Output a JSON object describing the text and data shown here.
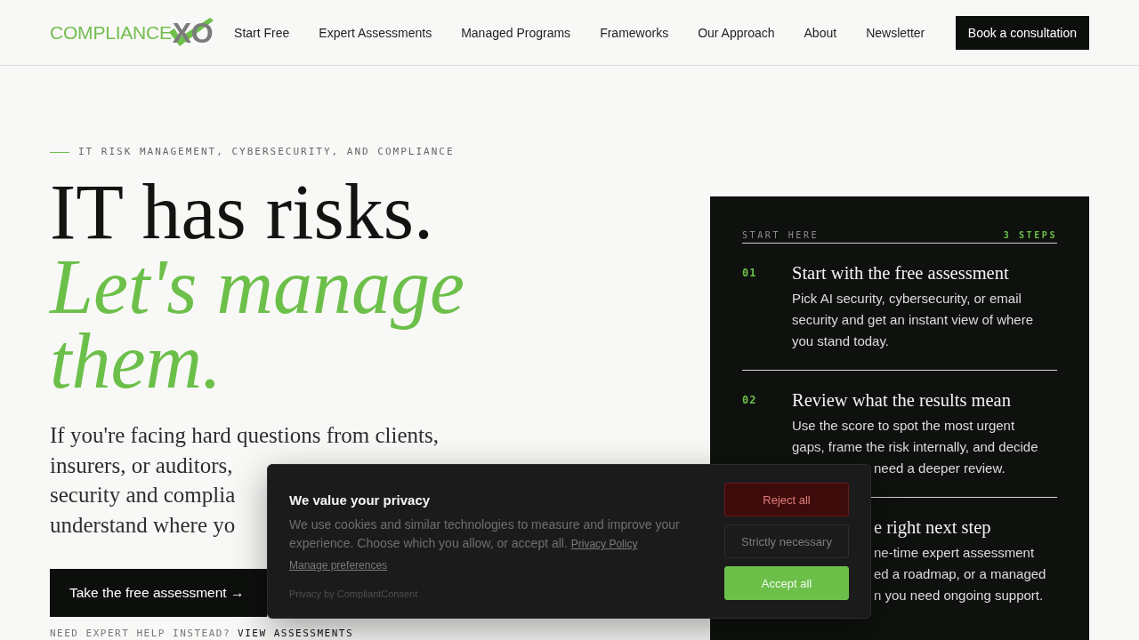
{
  "header": {
    "logo": {
      "wordmark": "COMPLIANCE",
      "letters": "XO"
    },
    "nav": [
      "Start Free",
      "Expert Assessments",
      "Managed Programs",
      "Frameworks",
      "Our Approach",
      "About",
      "Newsletter"
    ],
    "cta": "Book a consultation"
  },
  "hero": {
    "eyebrow": "IT RISK MANAGEMENT, CYBERSECURITY, AND COMPLIANCE",
    "headline": "IT has risks.",
    "headline_accent": "Let's manage them.",
    "intro_lines": [
      "If you're facing hard questions from clients,",
      "insurers, or auditors,",
      "security and complia",
      "understand where yo"
    ],
    "cta": "Take the free assessment →",
    "secondary_prompt": "NEED EXPERT HELP INSTEAD?",
    "secondary_link": "VIEW ASSESSMENTS"
  },
  "steps_panel": {
    "label": "START HERE",
    "count": "3 STEPS",
    "steps": [
      {
        "number": "01",
        "title": "Start with the free assessment",
        "text_lines": [
          "Pick AI security, cybersecurity, or email",
          "security and get an instant view of where",
          "you stand today."
        ]
      },
      {
        "number": "02",
        "title": "Review what the results mean",
        "text_lines": [
          "Use the score to spot the most urgent",
          "gaps, frame the risk internally, and decide"
        ],
        "text_fragments": [
          "need a deeper review."
        ]
      },
      {
        "title_fragment": "e right next step",
        "text_fragments": [
          "ne-time expert assessment",
          "ed a roadmap, or a managed",
          "n you need ongoing support."
        ]
      }
    ]
  },
  "cookie_banner": {
    "title": "We value your privacy",
    "text": "We use cookies and similar technologies to measure and improve your experience. Choose which you allow, or accept all.",
    "policy_link": "Privacy Policy",
    "preferences_link": "Manage preferences",
    "credit": "Privacy by CompliantConsent",
    "buttons": [
      {
        "label": "Reject all",
        "kind": "reject"
      },
      {
        "label": "Strictly necessary",
        "kind": "necessary"
      },
      {
        "label": "Accept all",
        "kind": "accept"
      }
    ]
  }
}
